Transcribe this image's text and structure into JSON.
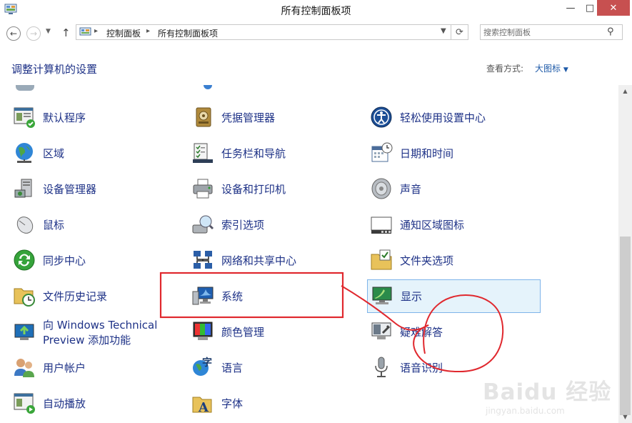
{
  "window": {
    "title": "所有控制面板项"
  },
  "nav": {
    "breadcrumbs": [
      "控制面板",
      "所有控制面板项"
    ],
    "search_placeholder": "搜索控制面板"
  },
  "header": {
    "heading": "调整计算机的设置",
    "view_by_label": "查看方式:",
    "view_by_value": "大图标"
  },
  "items": [
    {
      "label": "默认程序",
      "icon": "default-programs-icon"
    },
    {
      "label": "凭据管理器",
      "icon": "credential-manager-icon"
    },
    {
      "label": "轻松使用设置中心",
      "icon": "ease-of-access-icon"
    },
    {
      "label": "区域",
      "icon": "region-globe-icon"
    },
    {
      "label": "任务栏和导航",
      "icon": "taskbar-icon"
    },
    {
      "label": "日期和时间",
      "icon": "calendar-clock-icon"
    },
    {
      "label": "设备管理器",
      "icon": "device-manager-icon"
    },
    {
      "label": "设备和打印机",
      "icon": "printer-icon"
    },
    {
      "label": "声音",
      "icon": "speaker-icon"
    },
    {
      "label": "鼠标",
      "icon": "mouse-icon"
    },
    {
      "label": "索引选项",
      "icon": "indexing-icon"
    },
    {
      "label": "通知区域图标",
      "icon": "notification-area-icon"
    },
    {
      "label": "同步中心",
      "icon": "sync-center-icon"
    },
    {
      "label": "网络和共享中心",
      "icon": "network-icon"
    },
    {
      "label": "文件夹选项",
      "icon": "folder-options-icon"
    },
    {
      "label": "文件历史记录",
      "icon": "file-history-icon"
    },
    {
      "label": "系统",
      "icon": "system-icon"
    },
    {
      "label": "显示",
      "icon": "display-icon"
    },
    {
      "label": "向 Windows Technical Preview 添加功能",
      "icon": "add-features-icon"
    },
    {
      "label": "颜色管理",
      "icon": "color-management-icon"
    },
    {
      "label": "疑难解答",
      "icon": "troubleshooting-icon"
    },
    {
      "label": "用户帐户",
      "icon": "user-accounts-icon"
    },
    {
      "label": "语言",
      "icon": "language-icon"
    },
    {
      "label": "语音识别",
      "icon": "microphone-icon"
    },
    {
      "label": "自动播放",
      "icon": "autoplay-icon"
    },
    {
      "label": "字体",
      "icon": "fonts-icon"
    }
  ],
  "selected_item": "显示",
  "watermark": {
    "logo": "Baidu 经验",
    "url": "jingyan.baidu.com"
  },
  "colors": {
    "link": "#1e3287",
    "annotation": "#e0282e",
    "selection": "#e5f3fb"
  }
}
